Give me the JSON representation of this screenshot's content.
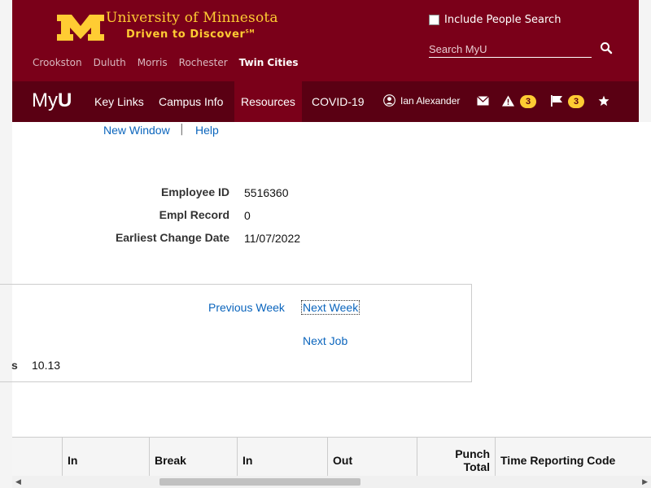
{
  "header": {
    "university_name": "University of Minnesota",
    "tagline": "Driven to Discover",
    "tagline_mark": "SM",
    "campuses": [
      "Crookston",
      "Duluth",
      "Morris",
      "Rochester",
      "Twin Cities"
    ],
    "active_campus": "Twin Cities",
    "people_search_label": "Include People Search",
    "search_placeholder": "Search MyU",
    "brand_color": "#7a0019",
    "accent_color": "#ffcc33"
  },
  "nav": {
    "logo_my": "My",
    "logo_u": "U",
    "items": [
      "Key Links",
      "Campus Info",
      "Resources",
      "COVID-19"
    ],
    "active_item": "Resources",
    "user_name": "Ian Alexander",
    "alerts_count": "3",
    "flags_count": "3",
    "icons": [
      "user-icon",
      "envelope-icon",
      "warning-icon",
      "flag-icon",
      "star-icon"
    ]
  },
  "toolbar": {
    "new_window": "New Window",
    "separator": "|",
    "help": "Help"
  },
  "employee": {
    "id_label": "Employee ID",
    "id_value": "5516360",
    "record_label": "Empl Record",
    "record_value": "0",
    "change_date_label": "Earliest Change Date",
    "change_date_value": "11/07/2022"
  },
  "panel": {
    "previous_week": "Previous Week",
    "next_week": "Next Week",
    "next_job": "Next Job",
    "partial_label": "s",
    "total_value": "10.13"
  },
  "table": {
    "columns": [
      "In",
      "Break",
      "In",
      "Out",
      "Punch Total",
      "Time Reporting Code"
    ],
    "punch_total_line1": "Punch",
    "punch_total_line2": "Total"
  }
}
